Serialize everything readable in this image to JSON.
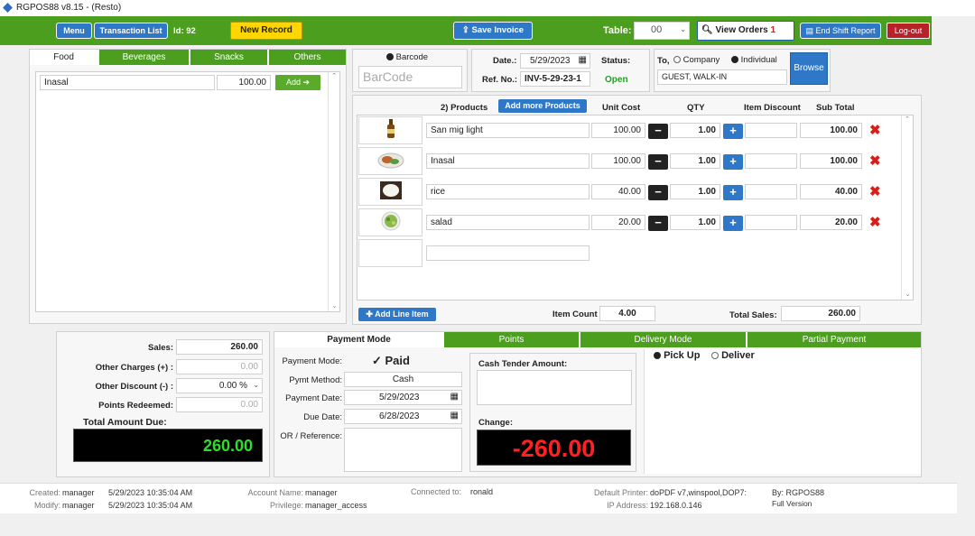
{
  "window": {
    "title": "RGPOS88 v8.15 - (Resto)"
  },
  "toolbar": {
    "menu": "Menu",
    "transaction_list": "Transaction List",
    "id_label": "Id: 92",
    "new_record": "New Record",
    "save_invoice": "Save Invoice",
    "table_label": "Table:",
    "table_value": "00",
    "view_orders": "View Orders",
    "view_orders_badge": "1",
    "end_shift": "End Shift Report",
    "logout": "Log-out"
  },
  "categories": {
    "tabs": [
      "Food",
      "Beverages",
      "Snacks",
      "Others"
    ],
    "active": "Food",
    "item_name": "Inasal",
    "item_price": "100.00",
    "add_label": "Add"
  },
  "barcode": {
    "radio_label": "Barcode",
    "placeholder": "BarCode"
  },
  "invoice": {
    "date_label": "Date.:",
    "date": "5/29/2023",
    "ref_label": "Ref. No.:",
    "ref": "INV-5-29-23-1",
    "status_label": "Status:",
    "status": "Open",
    "to_label": "To,",
    "company": "Company",
    "individual": "Individual",
    "customer": "GUEST, WALK-IN",
    "browse": "Browse"
  },
  "products": {
    "count_label": "2) Products",
    "add_more": "Add more Products",
    "headers": {
      "unit_cost": "Unit Cost",
      "qty": "QTY",
      "item_discount": "Item Discount",
      "subtotal": "Sub Total"
    },
    "rows": [
      {
        "name": "San mig light",
        "unit_cost": "100.00",
        "qty": "1.00",
        "discount": "",
        "subtotal": "100.00",
        "icon": "beer-bottle-icon"
      },
      {
        "name": "Inasal",
        "unit_cost": "100.00",
        "qty": "1.00",
        "discount": "",
        "subtotal": "100.00",
        "icon": "grilled-chicken-icon"
      },
      {
        "name": "rice",
        "unit_cost": "40.00",
        "qty": "1.00",
        "discount": "",
        "subtotal": "40.00",
        "icon": "rice-bowl-icon"
      },
      {
        "name": "salad",
        "unit_cost": "20.00",
        "qty": "1.00",
        "discount": "",
        "subtotal": "20.00",
        "icon": "salad-icon"
      }
    ],
    "add_line": "Add Line Item",
    "item_count_label": "Item Count",
    "item_count": "4.00",
    "total_sales_label": "Total Sales:",
    "total_sales": "260.00"
  },
  "summary": {
    "sales_label": "Sales:",
    "sales": "260.00",
    "other_charges_label": "Other Charges (+) :",
    "other_charges": "0.00",
    "other_discount_label": "Other Discount (-) :",
    "other_discount": "0.00 %",
    "points_label": "Points Redeemed:",
    "points": "0.00",
    "total_due_label": "Total Amount Due:",
    "total_due": "260.00"
  },
  "payment": {
    "tabs": [
      "Payment Mode",
      "Points",
      "Delivery Mode",
      "Partial Payment"
    ],
    "mode_label": "Payment Mode:",
    "mode": "Paid",
    "method_label": "Pymt Method:",
    "method": "Cash",
    "pay_date_label": "Payment Date:",
    "pay_date": "5/29/2023",
    "due_date_label": "Due Date:",
    "due_date": "6/28/2023",
    "or_label": "OR / Reference:",
    "cash_tender_label": "Cash Tender Amount:",
    "change_label": "Change:",
    "change": "-260.00",
    "pickup": "Pick Up",
    "deliver": "Deliver"
  },
  "footer": {
    "created_label": "Created:",
    "created_by": "manager",
    "created_at": "5/29/2023 10:35:04 AM",
    "modify_label": "Modify:",
    "modify_by": "manager",
    "modify_at": "5/29/2023 10:35:04 AM",
    "account_label": "Account Name:",
    "account": "manager",
    "privilege_label": "Privilege:",
    "privilege": "manager_access",
    "connected_label": "Connected to:",
    "connected": "ronald",
    "printer_label": "Default Printer:",
    "printer": "doPDF v7,winspool,DOP7:",
    "ip_label": "IP Address:",
    "ip": "192.168.0.146",
    "by": "By: RGPOS88",
    "version": "Full Version"
  },
  "colors": {
    "green": "#4c9f1e",
    "blue": "#2f78c8",
    "yellow": "#ffd600",
    "red": "#b8202a",
    "change_red": "#ff2020",
    "due_green": "#28e028"
  }
}
